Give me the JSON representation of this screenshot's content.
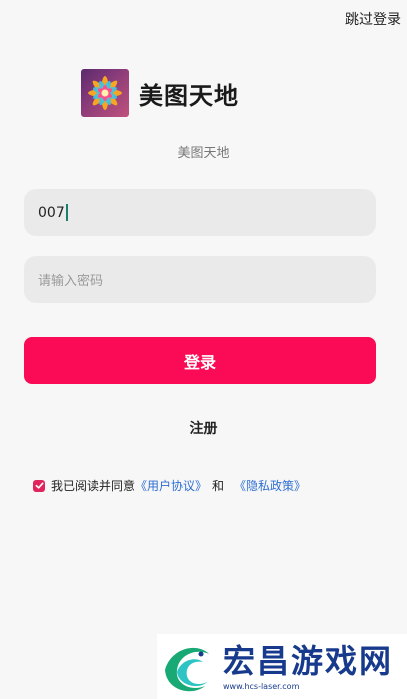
{
  "header": {
    "skip_label": "跳过登录"
  },
  "brand": {
    "name": "美图天地",
    "subtitle": "美图天地"
  },
  "form": {
    "account_value": "007",
    "password_placeholder": "请输入密码",
    "login_label": "登录",
    "register_label": "注册"
  },
  "agreement": {
    "checked": true,
    "prefix": "我已阅读并同意",
    "user_agreement": "《用户协议》",
    "and": "和",
    "privacy_policy": "《隐私政策》"
  },
  "watermark": {
    "title": "宏昌游戏网",
    "url": "www.hcs-laser.com"
  },
  "colors": {
    "primary": "#fb0a55",
    "link": "#2f6fd3",
    "background": "#f7f7f7",
    "input_bg": "#eaeaea",
    "checkbox": "#e0245e",
    "watermark": "#173a8c"
  }
}
